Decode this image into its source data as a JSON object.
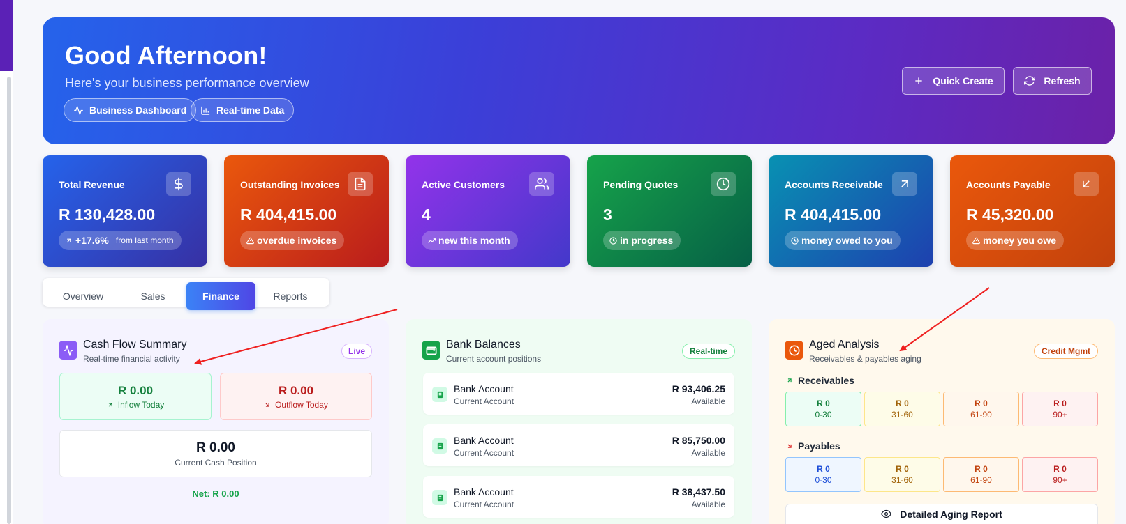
{
  "hero": {
    "greeting": "Good Afternoon!",
    "subtitle": "Here's your business performance overview",
    "pills": [
      "Business Dashboard",
      "Real-time Data"
    ],
    "quick_create": "Quick Create",
    "refresh": "Refresh"
  },
  "stats": [
    {
      "label": "Total Revenue",
      "value": "R 130,428.00",
      "tag": "+17.6%",
      "tag_suffix": "from last month",
      "icon": "dollar-icon",
      "color_from": "#2563eb",
      "color_to": "#3730a3"
    },
    {
      "label": "Outstanding Invoices",
      "value": "R 404,415.00",
      "tag": "overdue invoices",
      "icon": "file-text-icon",
      "color_from": "#ea580c",
      "color_to": "#b91c1c"
    },
    {
      "label": "Active Customers",
      "value": "4",
      "tag": "new this month",
      "icon": "users-icon",
      "color_from": "#9333ea",
      "color_to": "#4338ca"
    },
    {
      "label": "Pending Quotes",
      "value": "3",
      "tag": "in progress",
      "icon": "clock-icon",
      "color_from": "#16a34a",
      "color_to": "#065f46"
    },
    {
      "label": "Accounts Receivable",
      "value": "R 404,415.00",
      "tag": "money owed to you",
      "icon": "arrow-up-right-icon",
      "color_from": "#0891b2",
      "color_to": "#1e40af"
    },
    {
      "label": "Accounts Payable",
      "value": "R 45,320.00",
      "tag": "money you owe",
      "icon": "arrow-down-left-icon",
      "color_from": "#ea580c",
      "color_to": "#c2410c"
    }
  ],
  "tabs": [
    "Overview",
    "Sales",
    "Finance",
    "Reports"
  ],
  "active_tab": "Finance",
  "cash_flow": {
    "title": "Cash Flow Summary",
    "subtitle": "Real-time financial activity",
    "badge": "Live",
    "inflow_value": "R 0.00",
    "inflow_label": "Inflow Today",
    "outflow_value": "R 0.00",
    "outflow_label": "Outflow Today",
    "position_value": "R 0.00",
    "position_label": "Current Cash Position",
    "net": "Net: R 0.00"
  },
  "bank": {
    "title": "Bank Balances",
    "subtitle": "Current account positions",
    "badge": "Real-time",
    "accounts": [
      {
        "name": "Bank Account",
        "type": "Current Account",
        "amount": "R 93,406.25",
        "status": "Available"
      },
      {
        "name": "Bank Account",
        "type": "Current Account",
        "amount": "R 85,750.00",
        "status": "Available"
      },
      {
        "name": "Bank Account",
        "type": "Current Account",
        "amount": "R 38,437.50",
        "status": "Available"
      }
    ]
  },
  "aged": {
    "title": "Aged Analysis",
    "subtitle": "Receivables & payables aging",
    "badge": "Credit Mgmt",
    "receivables_label": "Receivables",
    "payables_label": "Payables",
    "receivables": [
      {
        "amount": "R 0",
        "range": "0-30"
      },
      {
        "amount": "R 0",
        "range": "31-60"
      },
      {
        "amount": "R 0",
        "range": "61-90"
      },
      {
        "amount": "R 0",
        "range": "90+"
      }
    ],
    "payables": [
      {
        "amount": "R 0",
        "range": "0-30"
      },
      {
        "amount": "R 0",
        "range": "31-60"
      },
      {
        "amount": "R 0",
        "range": "61-90"
      },
      {
        "amount": "R 0",
        "range": "90+"
      }
    ],
    "report_button": "Detailed Aging Report"
  }
}
